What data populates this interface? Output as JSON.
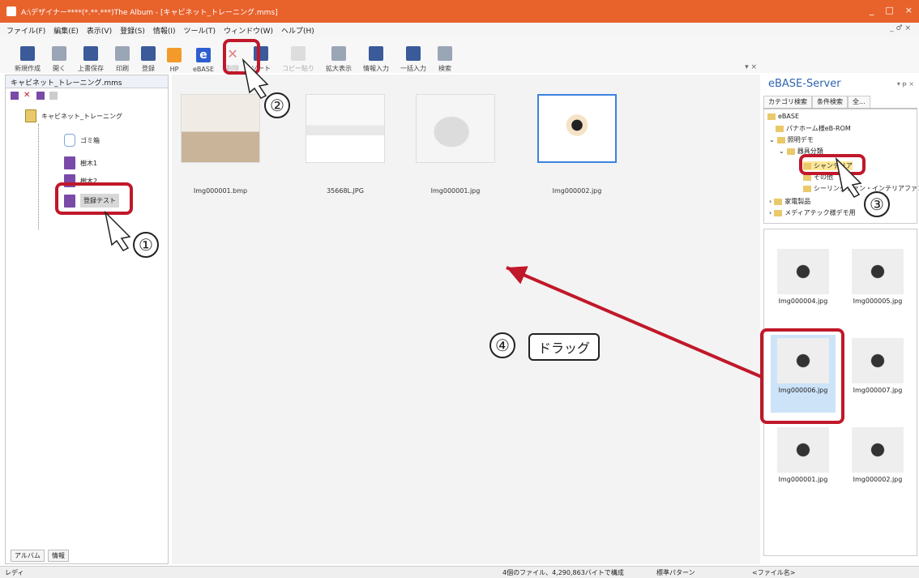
{
  "window": {
    "title": "A:\\デザイナー****(*.**.***)The Album - [キャビネット_トレーニング.mms]",
    "controls": [
      "_",
      "□",
      "×"
    ]
  },
  "menu": {
    "items": [
      "ファイル(F)",
      "編集(E)",
      "表示(V)",
      "登録(S)",
      "情報(I)",
      "ツール(T)",
      "ウィンドウ(W)",
      "ヘルプ(H)"
    ],
    "mini_ctl": "_ ♂ ×"
  },
  "toolbar": {
    "buttons": [
      {
        "label": "新規作成",
        "icon": "new-icon"
      },
      {
        "label": "開く",
        "icon": "open-icon"
      },
      {
        "label": "上書保存",
        "icon": "save-icon"
      },
      {
        "label": "印刷",
        "icon": "print-icon"
      },
      {
        "label": "登録",
        "icon": "register-icon"
      },
      {
        "label": "HP",
        "icon": "hp-icon"
      },
      {
        "label": "eBASE",
        "icon": "ebase-icon"
      },
      {
        "label": "削除",
        "icon": "delete-icon"
      },
      {
        "label": "ソート",
        "icon": "sort-icon"
      },
      {
        "label": "コピー貼り",
        "icon": "copy-icon"
      },
      {
        "label": "拡大表示",
        "icon": "zoom-view-icon"
      },
      {
        "label": "情報入力",
        "icon": "info-input-icon"
      },
      {
        "label": "一括入力",
        "icon": "bulk-input-icon"
      },
      {
        "label": "検索",
        "icon": "search-icon"
      }
    ]
  },
  "left_panel": {
    "tab": "キャビネット_トレーニング.mms",
    "tree": {
      "root": "キャビネット_トレーニング",
      "children": [
        "ゴミ箱",
        "樹木1",
        "樹木2",
        "登録テスト"
      ]
    },
    "bottom_tabs": [
      "アルバム",
      "情報"
    ]
  },
  "center": {
    "pin": "▾ ×",
    "files": [
      {
        "name": "Img000001.bmp"
      },
      {
        "name": "35668L.JPG"
      },
      {
        "name": "Img000001.jpg"
      },
      {
        "name": "Img000002.jpg"
      }
    ]
  },
  "right_panel": {
    "title": "eBASE-Server",
    "title_ctl": "▾ ᵽ ×",
    "tabs": [
      "カテゴリ検索",
      "条件検索",
      "全..."
    ],
    "tree": [
      {
        "label": "eBASE",
        "level": 0
      },
      {
        "label": "パナホーム様eB-ROM",
        "level": 1
      },
      {
        "label": "照明デモ",
        "level": 1
      },
      {
        "label": "器具分類",
        "level": 2
      },
      {
        "label": "シャンデリア",
        "level": 3
      },
      {
        "label": "その他",
        "level": 3
      },
      {
        "label": "シーリングファン・インテリアファン",
        "level": 3
      },
      {
        "label": "家電製品",
        "level": 1
      },
      {
        "label": "メディアテック様デモ用",
        "level": 1
      }
    ],
    "gallery": [
      "Img000004.jpg",
      "Img000005.jpg",
      "Img000006.jpg",
      "Img000007.jpg",
      "Img000001.jpg",
      "Img000002.jpg"
    ]
  },
  "status": {
    "left": "レディ",
    "info": "4個のファイル、4,290,863バイトで構成",
    "pattern": "標準パターン",
    "sort": "<ファイル名>"
  },
  "annotations": {
    "n1": "①",
    "n2": "②",
    "n3": "③",
    "n4": "④",
    "drag": "ドラッグ"
  },
  "colors": {
    "title_bar": "#e8622c",
    "highlight": "#c0182a",
    "ebase_blue": "#2d5fd1"
  }
}
